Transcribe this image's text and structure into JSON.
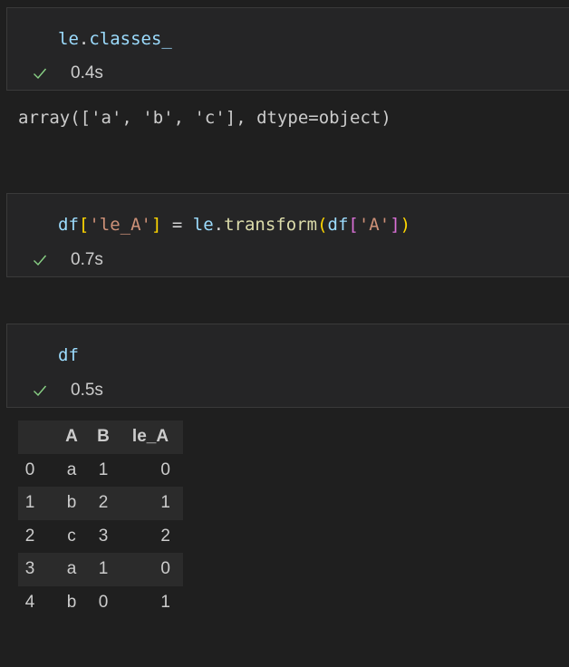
{
  "cells": [
    {
      "code": {
        "object": "le",
        "dot": ".",
        "attr": "classes_"
      },
      "time": "0.4s"
    },
    {
      "code": {
        "df1": "df",
        "open1": "[",
        "key1": "'le_A'",
        "close1": "]",
        "assign": " = ",
        "obj": "le",
        "dot": ".",
        "fn": "transform",
        "paren_open": "(",
        "df2": "df",
        "open2": "[",
        "key2": "'A'",
        "close2": "]",
        "paren_close": ")"
      },
      "time": "0.7s"
    },
    {
      "code": {
        "df": "df"
      },
      "time": "0.5s"
    }
  ],
  "output1": "array(['a', 'b', 'c'], dtype=object)",
  "dataframe": {
    "columns": [
      "A",
      "B",
      "le_A"
    ],
    "rows": [
      {
        "index": "0",
        "A": "a",
        "B": "1",
        "le_A": "0"
      },
      {
        "index": "1",
        "A": "b",
        "B": "2",
        "le_A": "1"
      },
      {
        "index": "2",
        "A": "c",
        "B": "3",
        "le_A": "2"
      },
      {
        "index": "3",
        "A": "a",
        "B": "1",
        "le_A": "0"
      },
      {
        "index": "4",
        "A": "b",
        "B": "0",
        "le_A": "1"
      }
    ]
  },
  "colors": {
    "success_check": "#89d185",
    "background": "#1f1f1f",
    "cell_background": "#252526"
  },
  "icons": {
    "status": "check-icon"
  }
}
